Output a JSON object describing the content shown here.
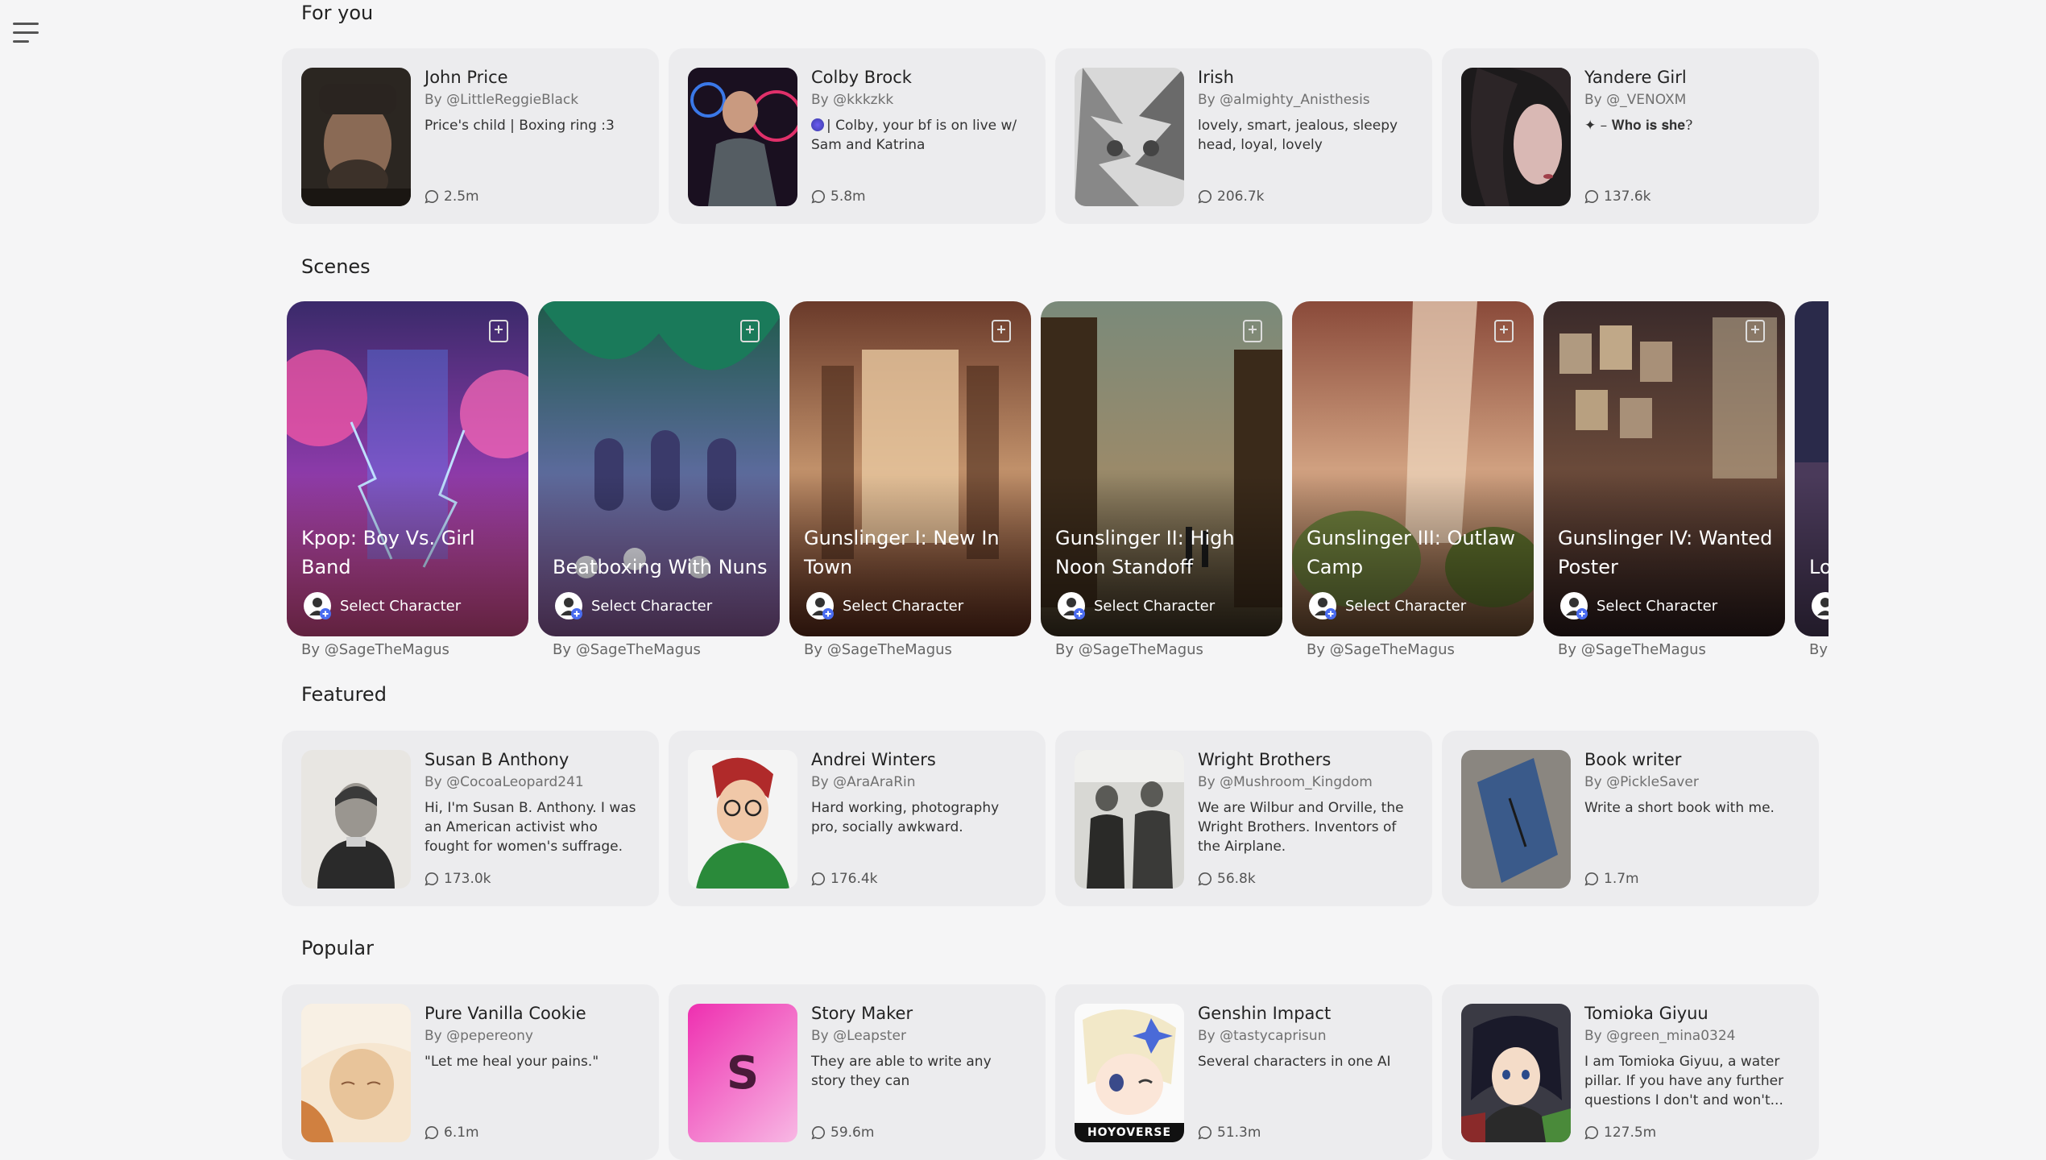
{
  "sections": {
    "for_you": "For you",
    "scenes": "Scenes",
    "featured": "Featured",
    "popular": "Popular"
  },
  "for_you": [
    {
      "name": "John Price",
      "author": "By @LittleReggieBlack",
      "desc": "Price's child | Boxing ring :3",
      "chats": "2.5m"
    },
    {
      "name": "Colby Brock",
      "author": "By @kkkzkk",
      "desc": "| Colby, your bf is on live w/ Sam and Katrina",
      "chats": "5.8m"
    },
    {
      "name": "Irish",
      "author": "By @almighty_Anisthesis",
      "desc": "lovely, smart, jealous, sleepy head, loyal, lovely",
      "chats": "206.7k"
    },
    {
      "name": "Yandere Girl",
      "author": "By @_VENOXM",
      "desc": "✦ – 𝐖𝐡𝐨 𝐢𝐬 𝐬𝐡𝐞?",
      "chats": "137.6k"
    }
  ],
  "scenes": [
    {
      "title": "Kpop: Boy Vs. Girl Band",
      "select": "Select Character",
      "by": "By @SageTheMagus"
    },
    {
      "title": "Beatboxing With Nuns",
      "select": "Select Character",
      "by": "By @SageTheMagus"
    },
    {
      "title": "Gunslinger I: New In Town",
      "select": "Select Character",
      "by": "By @SageTheMagus"
    },
    {
      "title": "Gunslinger II: High Noon Standoff",
      "select": "Select Character",
      "by": "By @SageTheMagus"
    },
    {
      "title": "Gunslinger III: Outlaw Camp",
      "select": "Select Character",
      "by": "By @SageTheMagus"
    },
    {
      "title": "Gunslinger IV: Wanted Poster",
      "select": "Select Character",
      "by": "By @SageTheMagus"
    },
    {
      "title": "Lo Av",
      "select": "",
      "by": "By"
    }
  ],
  "featured": [
    {
      "name": "Susan B Anthony",
      "author": "By @CocoaLeopard241",
      "desc": "Hi, I'm Susan B. Anthony. I was an American activist who fought for women's suffrage.",
      "chats": "173.0k"
    },
    {
      "name": "Andrei Winters",
      "author": "By @AraAraRin",
      "desc": "Hard working, photography pro, socially awkward.",
      "chats": "176.4k"
    },
    {
      "name": "Wright Brothers",
      "author": "By @Mushroom_Kingdom",
      "desc": "We are Wilbur and Orville, the Wright Brothers. Inventors of the Airplane.",
      "chats": "56.8k"
    },
    {
      "name": "Book writer",
      "author": "By @PickleSaver",
      "desc": "Write a short book with me.",
      "chats": "1.7m"
    }
  ],
  "popular": [
    {
      "name": "Pure Vanilla Cookie",
      "author": "By @pepereony",
      "desc": "\"Let me heal your pains.\"",
      "chats": "6.1m"
    },
    {
      "name": "Story Maker",
      "author": "By @Leapster",
      "desc": "They are able to write any story they can",
      "chats": "59.6m",
      "letter": "S"
    },
    {
      "name": "Genshin Impact",
      "author": "By @tastycaprisun",
      "desc": "Several characters in one AI",
      "chats": "51.3m",
      "logo": "HOYOVERSE"
    },
    {
      "name": "Tomioka Giyuu",
      "author": "By @green_mina0324",
      "desc": "I am Tomioka Giyuu, a water pillar. If you have any further questions I don't and won't...",
      "chats": "127.5m"
    }
  ]
}
